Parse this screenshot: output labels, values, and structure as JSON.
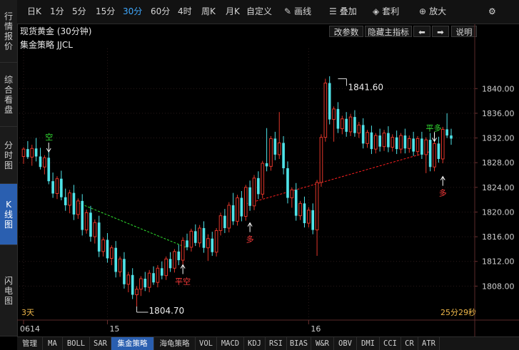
{
  "sidebar": {
    "items": [
      {
        "label": "行情报价",
        "active": false
      },
      {
        "label": "综合看盘",
        "active": false
      },
      {
        "label": "分时图",
        "active": false
      },
      {
        "label": "K线图",
        "active": true
      },
      {
        "label": "闪电图",
        "active": false
      }
    ]
  },
  "toolbar": {
    "periods": [
      "日K",
      "1分",
      "5分",
      "15分",
      "30分",
      "60分",
      "4时",
      "周K",
      "月K",
      "自定义"
    ],
    "active_period": "30分",
    "draw_label": "画线",
    "overlay_label": "叠加",
    "arbitrage_label": "套利",
    "zoom_label": "放大"
  },
  "header": {
    "title": "现货黄金 (30分钟)",
    "change_params": "改参数",
    "hide_indicator": "隐藏主指标",
    "prev_arrow": "⬅",
    "next_arrow": "➡",
    "explain": "说明"
  },
  "strategy_label": "集金策略 JJCL",
  "colors": {
    "up": "#e0362a",
    "down": "#4fe3e8",
    "grid": "#2a1a1a",
    "axis_text": "#cfcfcf",
    "buy_signal": "#ff3b3b",
    "close_signal": "#34e034",
    "trend_red": "#ff2020",
    "trend_green": "#2fe02f"
  },
  "chart_data": {
    "type": "candlestick",
    "yticks": [
      1808,
      1812,
      1816,
      1820,
      1824,
      1828,
      1832,
      1836,
      1840
    ],
    "ylim": [
      1802.5,
      1846.5
    ],
    "xticks": [
      {
        "index": 0,
        "label": "0614"
      },
      {
        "index": 20,
        "label": "15"
      },
      {
        "index": 68,
        "label": "16"
      }
    ],
    "annotations": {
      "high_label": "1841.60",
      "high_index": 75,
      "high_value": 1841.6,
      "low_label": "1804.70",
      "low_index": 27,
      "low_value": 1804.7
    },
    "signals": [
      {
        "type": "short",
        "index": 6,
        "price": 1829.4,
        "label": "空",
        "text": "空"
      },
      {
        "type": "close-short",
        "index": 38,
        "price": 1811.8,
        "label": "平空",
        "text": "平空"
      },
      {
        "type": "long",
        "index": 54,
        "price": 1818.6,
        "label": "多",
        "text": "多"
      },
      {
        "type": "close-long",
        "index": 98,
        "price": 1831.1,
        "label": "平多",
        "text": "平多"
      },
      {
        "type": "long",
        "index": 100,
        "price": 1826.1,
        "label": "多",
        "text": "多"
      }
    ],
    "trendlines": [
      {
        "color": "green",
        "from": {
          "index": 13,
          "value": 1821.5
        },
        "to": {
          "index": 39,
          "value": 1814.2
        }
      },
      {
        "color": "red",
        "from": {
          "index": 53,
          "value": 1821.3
        },
        "to": {
          "index": 97,
          "value": 1829.8
        }
      }
    ],
    "days_label": "3天",
    "countdown": "25分29秒",
    "candles": [
      [
        1829.0,
        1830.5,
        1827.8,
        1830.2
      ],
      [
        1830.2,
        1831.5,
        1828.6,
        1828.9
      ],
      [
        1828.9,
        1830.9,
        1827.5,
        1830.3
      ],
      [
        1830.3,
        1832.0,
        1828.2,
        1829.0
      ],
      [
        1829.0,
        1830.4,
        1826.9,
        1827.3
      ],
      [
        1827.3,
        1829.2,
        1826.1,
        1828.8
      ],
      [
        1828.8,
        1829.9,
        1824.5,
        1825.0
      ],
      [
        1825.0,
        1826.4,
        1822.3,
        1823.0
      ],
      [
        1823.0,
        1825.8,
        1822.1,
        1825.4
      ],
      [
        1825.4,
        1826.7,
        1821.9,
        1822.4
      ],
      [
        1822.4,
        1823.8,
        1820.2,
        1821.1
      ],
      [
        1821.1,
        1823.6,
        1819.8,
        1823.1
      ],
      [
        1823.1,
        1824.4,
        1818.7,
        1819.6
      ],
      [
        1819.6,
        1822.2,
        1818.9,
        1821.8
      ],
      [
        1821.8,
        1822.9,
        1816.2,
        1817.1
      ],
      [
        1817.1,
        1820.4,
        1816.5,
        1819.9
      ],
      [
        1819.9,
        1821.0,
        1815.2,
        1816.0
      ],
      [
        1816.0,
        1818.8,
        1814.9,
        1818.3
      ],
      [
        1818.3,
        1819.4,
        1812.7,
        1813.6
      ],
      [
        1813.6,
        1815.9,
        1812.8,
        1815.5
      ],
      [
        1815.5,
        1816.6,
        1811.8,
        1812.5
      ],
      [
        1812.5,
        1814.6,
        1811.4,
        1814.2
      ],
      [
        1814.2,
        1815.3,
        1809.4,
        1810.3
      ],
      [
        1810.3,
        1812.8,
        1809.5,
        1812.4
      ],
      [
        1812.4,
        1813.5,
        1807.6,
        1808.3
      ],
      [
        1808.3,
        1810.3,
        1807.0,
        1809.8
      ],
      [
        1809.8,
        1810.9,
        1805.9,
        1806.6
      ],
      [
        1806.6,
        1808.0,
        1804.7,
        1807.5
      ],
      [
        1807.5,
        1809.6,
        1806.4,
        1809.2
      ],
      [
        1809.2,
        1810.3,
        1807.2,
        1807.8
      ],
      [
        1807.8,
        1810.6,
        1807.0,
        1810.1
      ],
      [
        1810.1,
        1811.2,
        1808.2,
        1808.6
      ],
      [
        1808.6,
        1811.4,
        1807.8,
        1810.9
      ],
      [
        1810.9,
        1812.0,
        1809.1,
        1809.7
      ],
      [
        1809.7,
        1812.8,
        1809.0,
        1812.4
      ],
      [
        1812.4,
        1813.5,
        1810.3,
        1810.9
      ],
      [
        1810.9,
        1814.0,
        1810.2,
        1813.6
      ],
      [
        1813.6,
        1814.7,
        1811.4,
        1812.2
      ],
      [
        1812.2,
        1815.9,
        1811.5,
        1815.4
      ],
      [
        1815.4,
        1816.5,
        1813.8,
        1814.3
      ],
      [
        1814.3,
        1817.3,
        1813.6,
        1816.9
      ],
      [
        1816.9,
        1818.0,
        1814.5,
        1815.0
      ],
      [
        1815.0,
        1817.9,
        1814.3,
        1817.4
      ],
      [
        1817.4,
        1818.5,
        1813.4,
        1814.2
      ],
      [
        1814.2,
        1816.4,
        1812.1,
        1815.7
      ],
      [
        1815.7,
        1816.8,
        1812.9,
        1813.5
      ],
      [
        1813.5,
        1817.4,
        1812.8,
        1817.0
      ],
      [
        1817.0,
        1819.9,
        1816.2,
        1819.4
      ],
      [
        1819.4,
        1820.5,
        1816.6,
        1817.4
      ],
      [
        1817.4,
        1821.6,
        1816.7,
        1821.1
      ],
      [
        1821.1,
        1823.1,
        1817.9,
        1818.5
      ],
      [
        1818.5,
        1822.8,
        1817.8,
        1822.3
      ],
      [
        1822.3,
        1823.4,
        1818.5,
        1819.3
      ],
      [
        1819.3,
        1824.4,
        1818.6,
        1824.0
      ],
      [
        1824.0,
        1825.1,
        1820.2,
        1821.0
      ],
      [
        1821.0,
        1826.0,
        1820.3,
        1825.5
      ],
      [
        1825.5,
        1826.6,
        1822.1,
        1822.9
      ],
      [
        1822.9,
        1828.3,
        1822.2,
        1827.9
      ],
      [
        1827.9,
        1833.6,
        1826.6,
        1827.4
      ],
      [
        1827.4,
        1832.3,
        1826.7,
        1831.9
      ],
      [
        1831.9,
        1833.0,
        1828.4,
        1829.3
      ],
      [
        1829.3,
        1836.2,
        1828.6,
        1831.2
      ],
      [
        1831.2,
        1832.3,
        1826.1,
        1827.1
      ],
      [
        1827.1,
        1828.2,
        1821.4,
        1822.3
      ],
      [
        1822.3,
        1824.0,
        1820.7,
        1823.6
      ],
      [
        1823.6,
        1824.7,
        1818.6,
        1819.4
      ],
      [
        1819.4,
        1821.8,
        1818.7,
        1821.4
      ],
      [
        1821.4,
        1822.5,
        1817.5,
        1818.2
      ],
      [
        1818.2,
        1820.8,
        1817.5,
        1820.3
      ],
      [
        1820.3,
        1821.4,
        1816.4,
        1817.1
      ],
      [
        1817.1,
        1825.2,
        1812.9,
        1824.8
      ],
      [
        1824.8,
        1832.6,
        1824.1,
        1832.1
      ],
      [
        1832.1,
        1841.6,
        1831.4,
        1840.9
      ],
      [
        1840.9,
        1842.0,
        1834.2,
        1835.0
      ],
      [
        1835.0,
        1837.1,
        1831.4,
        1836.7
      ],
      [
        1836.7,
        1837.8,
        1832.8,
        1833.5
      ],
      [
        1833.5,
        1835.6,
        1832.6,
        1835.1
      ],
      [
        1835.1,
        1836.2,
        1832.2,
        1833.0
      ],
      [
        1833.0,
        1835.9,
        1832.3,
        1835.4
      ],
      [
        1835.4,
        1836.5,
        1832.2,
        1832.8
      ],
      [
        1832.8,
        1834.6,
        1832.0,
        1834.1
      ],
      [
        1834.1,
        1835.2,
        1830.3,
        1831.1
      ],
      [
        1831.1,
        1833.3,
        1830.4,
        1832.9
      ],
      [
        1832.9,
        1834.0,
        1829.4,
        1830.2
      ],
      [
        1830.2,
        1832.8,
        1829.5,
        1832.4
      ],
      [
        1832.4,
        1833.5,
        1829.8,
        1830.6
      ],
      [
        1830.6,
        1833.3,
        1829.9,
        1832.8
      ],
      [
        1832.8,
        1833.9,
        1829.7,
        1830.5
      ],
      [
        1830.5,
        1832.6,
        1829.8,
        1832.1
      ],
      [
        1832.1,
        1833.2,
        1829.4,
        1830.2
      ],
      [
        1830.2,
        1832.8,
        1829.5,
        1832.4
      ],
      [
        1832.4,
        1833.5,
        1829.5,
        1830.3
      ],
      [
        1830.3,
        1832.4,
        1829.6,
        1831.9
      ],
      [
        1831.9,
        1833.0,
        1829.1,
        1829.8
      ],
      [
        1829.8,
        1832.3,
        1829.1,
        1831.9
      ],
      [
        1831.9,
        1833.0,
        1828.6,
        1829.3
      ],
      [
        1829.3,
        1832.1,
        1826.3,
        1831.7
      ],
      [
        1831.7,
        1832.8,
        1826.6,
        1827.3
      ],
      [
        1827.3,
        1831.5,
        1826.6,
        1831.1
      ],
      [
        1831.1,
        1832.2,
        1828.0,
        1828.6
      ],
      [
        1828.6,
        1833.8,
        1827.9,
        1833.4
      ],
      [
        1833.4,
        1836.0,
        1832.0,
        1832.4
      ],
      [
        1832.4,
        1833.5,
        1830.9,
        1831.9
      ]
    ]
  }
}
